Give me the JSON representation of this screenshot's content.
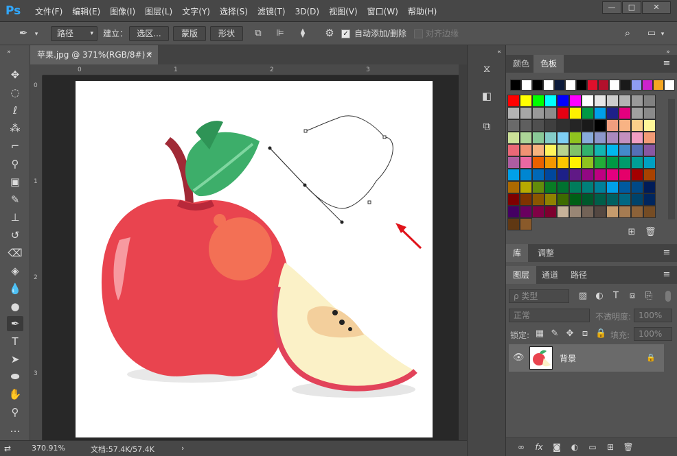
{
  "app": {
    "logo": "Ps"
  },
  "menu": [
    "文件(F)",
    "编辑(E)",
    "图像(I)",
    "图层(L)",
    "文字(Y)",
    "选择(S)",
    "滤镜(T)",
    "3D(D)",
    "视图(V)",
    "窗口(W)",
    "帮助(H)"
  ],
  "window_controls": {
    "minimize": "—",
    "restore": "□",
    "close": "✕"
  },
  "options": {
    "mode": "路径",
    "make_label": "建立：",
    "selection_btn": "选区...",
    "mask_btn": "蒙版",
    "shape_btn": "形状",
    "auto_add_label": "自动添加/删除",
    "auto_add_checked": true,
    "align_edges_label": "对齐边缘"
  },
  "document": {
    "tab_title": "苹果.jpg @ 371%(RGB/8#) *",
    "close": "×",
    "ruler_h": [
      "0",
      "1",
      "2",
      "3"
    ],
    "ruler_v": [
      "0",
      "1",
      "2",
      "3"
    ]
  },
  "status": {
    "zoom": "370.91%",
    "doc_info": "文档:57.4K/57.4K",
    "arrow": "›"
  },
  "panels": {
    "color_tabs": [
      "颜色",
      "色板"
    ],
    "color_active": 1,
    "lib_tabs": [
      "库",
      "调整"
    ],
    "layer_tabs": [
      "图层",
      "通道",
      "路径"
    ],
    "filter_type": "ρ 类型",
    "blend_mode": "正常",
    "opacity_label": "不透明度:",
    "opacity_value": "100%",
    "lock_label": "锁定:",
    "fill_label": "填充:",
    "fill_value": "100%",
    "layer_name": "背景",
    "menu_icon": "≡"
  },
  "swatches_top": [
    "#000000",
    "#ffffff",
    "#000000",
    "#ffffff",
    "#0c1a3a",
    "#ffffff",
    "#000000",
    "#e0102c",
    "#b2102c",
    "#ffffff",
    "#1a1a1a",
    "#8f9cf2",
    "#cc22cc",
    "#f5a623",
    "#ffffff"
  ],
  "swatch_grid": [
    [
      "#ff0000",
      "#ffff00",
      "#00ff00",
      "#00ffff",
      "#0000ff",
      "#ff00ff",
      "#ffffff",
      "#e6e6e6",
      "#cccccc",
      "#b3b3b3",
      "#999999",
      "#808080"
    ],
    [
      "#b3b3b3",
      "#a6a6a6",
      "#999999",
      "#8c8c8c",
      "#e60012",
      "#fff100",
      "#009944",
      "#00a0e9",
      "#1d2088",
      "#e4007f",
      "#a0a0a0",
      "#8a8a8a"
    ],
    [
      "#6a6a6a",
      "#5f5f5f",
      "#4f4f4f",
      "#3f3f3f",
      "#303030",
      "#252525",
      "#1a1a1a",
      "#000000",
      "#f19e7f",
      "#f8b384",
      "#fcd08a",
      "#fff799"
    ],
    [
      "#cce198",
      "#acd598",
      "#89c997",
      "#84ccc9",
      "#7ecef4",
      "#8fc31f",
      "#88abda",
      "#8c97cb",
      "#aa89bd",
      "#c490bf",
      "#f19ec2",
      "#f29b76"
    ],
    [
      "#eb6877",
      "#f09273",
      "#f6b37f",
      "#fff45c",
      "#b8d38f",
      "#80c269",
      "#32b16c",
      "#13b5b1",
      "#00b7ee",
      "#448aca",
      "#556fb5",
      "#8957a1"
    ],
    [
      "#ae5da1",
      "#ea68a2",
      "#eb6100",
      "#f39800",
      "#fcc800",
      "#fff100",
      "#8fc31f",
      "#22ac38",
      "#009944",
      "#009b6b",
      "#009e96",
      "#00a0c1"
    ],
    [
      "#00a0e9",
      "#0086d1",
      "#0068b7",
      "#00479d",
      "#1d2088",
      "#601986",
      "#920783",
      "#be0081",
      "#e4007f",
      "#e5006a",
      "#a40000",
      "#a84200"
    ],
    [
      "#ac6a00",
      "#b7aa00",
      "#638c0b",
      "#097c25",
      "#007130",
      "#007c5c",
      "#007f7a",
      "#008099",
      "#00a0e9",
      "#005aa0",
      "#004986",
      "#001c58"
    ],
    [
      "#7d0000",
      "#7f3300",
      "#8a5600",
      "#8f8200",
      "#3e6a00",
      "#005e15",
      "#00582b",
      "#005e49",
      "#006061",
      "#006783",
      "#00436b",
      "#00265e"
    ],
    [
      "#440062",
      "#6a005f",
      "#800046",
      "#7d002e",
      "#c7b299",
      "#998675",
      "#736357",
      "#534741",
      "#c69c6d",
      "#a67c52",
      "#8c6239",
      "#754c24"
    ],
    [
      "#603813",
      "#8a5a2a"
    ]
  ]
}
